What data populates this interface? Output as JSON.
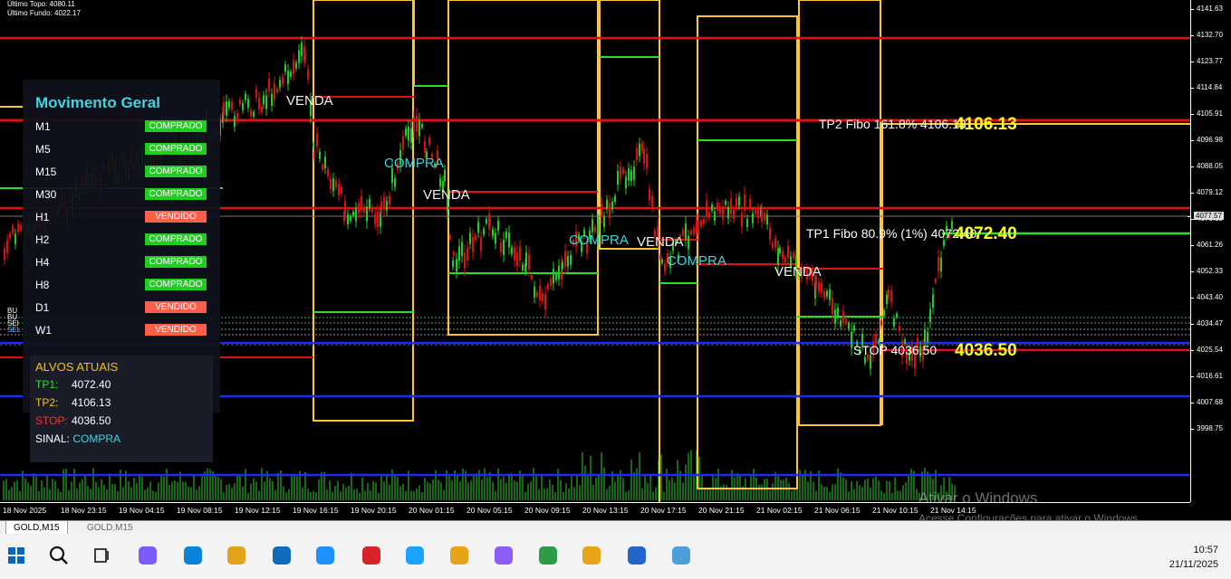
{
  "top_info": {
    "line1": "Último Topo: 4080.11",
    "line2": "Último Fundo: 4022.17"
  },
  "price_axis": [
    "4141.63",
    "4132.70",
    "4123.77",
    "4114.84",
    "4105.91",
    "4096.98",
    "4088.05",
    "4079.12",
    "4070.19",
    "4061.26",
    "4052.33",
    "4043.40",
    "4034.47",
    "4025.54",
    "4016.61",
    "4007.68",
    "3998.75"
  ],
  "current_price": "4077.57",
  "time_axis": [
    "18 Nov 2025",
    "18 Nov 23:15",
    "19 Nov 04:15",
    "19 Nov 08:15",
    "19 Nov 12:15",
    "19 Nov 16:15",
    "19 Nov 20:15",
    "20 Nov 01:15",
    "20 Nov 05:15",
    "20 Nov 09:15",
    "20 Nov 13:15",
    "20 Nov 17:15",
    "20 Nov 21:15",
    "21 Nov 02:15",
    "21 Nov 06:15",
    "21 Nov 10:15",
    "21 Nov 14:15"
  ],
  "annotations": {
    "venda1": "VENDA",
    "compra1": "COMPRA",
    "venda2": "VENDA",
    "compra2": "COMPRA",
    "venda3": "VENDA",
    "compra3": "COMPRA",
    "venda4": "VENDA",
    "stop": "STOP 4036.50"
  },
  "levels": {
    "tp2_text": "TP2 Fibo 161.8% 4106.13",
    "tp2_big": "4106.13",
    "tp1_text": "TP1 Fibo 80.9% (1%) 4072.40",
    "tp1_big": "4072.40",
    "stop_big": "4036.50"
  },
  "left_tags": [
    "BU",
    "BU",
    "SEI",
    "SEL"
  ],
  "panel": {
    "title": "Movimento Geral",
    "rows": [
      {
        "tf": "M1",
        "status": "COMPRADO",
        "color": "#22cc22"
      },
      {
        "tf": "M5",
        "status": "COMPRADO",
        "color": "#22cc22"
      },
      {
        "tf": "M15",
        "status": "COMPRADO",
        "color": "#22cc22"
      },
      {
        "tf": "M30",
        "status": "COMPRADO",
        "color": "#22cc22"
      },
      {
        "tf": "H1",
        "status": "VENDIDO",
        "color": "#ff5e4a"
      },
      {
        "tf": "H2",
        "status": "COMPRADO",
        "color": "#22cc22"
      },
      {
        "tf": "H4",
        "status": "COMPRADO",
        "color": "#22cc22"
      },
      {
        "tf": "H8",
        "status": "COMPRADO",
        "color": "#22cc22"
      },
      {
        "tf": "D1",
        "status": "VENDIDO",
        "color": "#ff5e4a"
      },
      {
        "tf": "W1",
        "status": "VENDIDO",
        "color": "#ff5e4a"
      }
    ]
  },
  "alvos": {
    "title": "ALVOS ATUAIS",
    "tp1_label": "TP1:",
    "tp1_value": "4072.40",
    "tp2_label": "TP2:",
    "tp2_value": "4106.13",
    "stop_label": "STOP:",
    "stop_value": "4036.50",
    "sinal_label": "SINAL:",
    "sinal_value": "COMPRA"
  },
  "tabs": {
    "active": "GOLD,M15",
    "inactive": "GOLD,M15"
  },
  "watermark": {
    "line1": "Ativar o Windows",
    "line2": "Acesse Configurações para ativar o Windows."
  },
  "clock": {
    "time": "10:57",
    "date": "21/11/2025"
  },
  "taskbar_icons": [
    "windows-start-icon",
    "search-icon",
    "task-view-icon",
    "copilot-icon",
    "edge-icon",
    "file-explorer-icon",
    "microsoft-store-icon",
    "mail-icon",
    "game-app-icon",
    "vpn-shield-icon",
    "trading-app-icon",
    "messaging-app-icon",
    "finance-app-icon",
    "trading-app-2-icon",
    "remote-desktop-icon",
    "paint-icon"
  ],
  "colors": {
    "buy": "#22cc22",
    "sell": "#ff5e4a",
    "red_line": "#e01010",
    "blue_line": "#1a2cff",
    "yellow_box": "#ffc433",
    "green_line": "#2adf2a"
  }
}
